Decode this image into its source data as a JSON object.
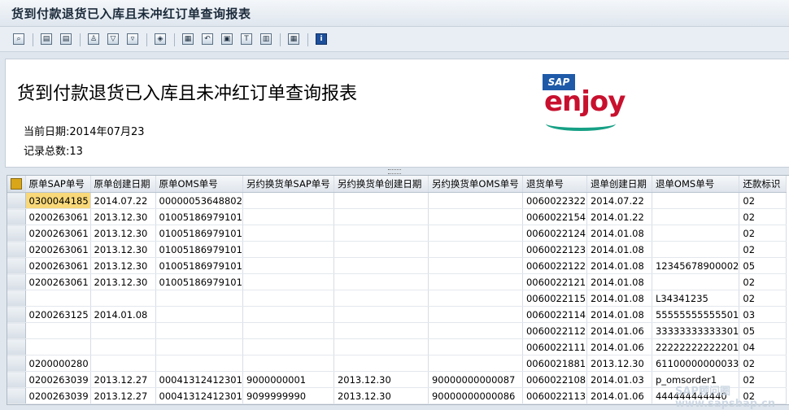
{
  "window": {
    "title": "货到付款退货已入库且未冲红订单查询报表"
  },
  "toolbar": {
    "buttons": [
      {
        "name": "details-icon",
        "glyph": "⌕"
      },
      {
        "name": "sort-ascending-icon",
        "glyph": "▤"
      },
      {
        "name": "sort-descending-icon",
        "glyph": "▤"
      },
      {
        "name": "find-icon",
        "glyph": "♙"
      },
      {
        "name": "filter-icon",
        "glyph": "▽"
      },
      {
        "name": "filter-settings-icon",
        "glyph": "▿"
      },
      {
        "name": "print-preview-icon",
        "glyph": "◈"
      },
      {
        "name": "export-icon",
        "glyph": "▦"
      },
      {
        "name": "send-icon",
        "glyph": "↶"
      },
      {
        "name": "abc-analysis-icon",
        "glyph": "▣"
      },
      {
        "name": "graphic-icon",
        "glyph": "T"
      },
      {
        "name": "layout-icon",
        "glyph": "▥"
      },
      {
        "name": "select-layout-icon",
        "glyph": "▦"
      },
      {
        "name": "info-icon",
        "glyph": "i"
      }
    ]
  },
  "header": {
    "title": "货到付款退货已入库且未冲红订单查询报表",
    "date_line": "当前日期:2014年07月23",
    "count_line": "记录总数:13",
    "logo": {
      "brand": "SAP",
      "word": "enjoy"
    }
  },
  "grid": {
    "columns": [
      "原单SAP单号",
      "原单创建日期",
      "原单OMS单号",
      "另约换货单SAP单号",
      "另约换货单创建日期",
      "另约换货单OMS单号",
      "退货单号",
      "退单创建日期",
      "退单OMS单号",
      "还款标识"
    ],
    "rows": [
      [
        "0300044185",
        "2014.07.22",
        "00000053648802",
        "",
        "",
        "",
        "0060022322",
        "2014.07.22",
        "",
        "02"
      ],
      [
        "0200263061",
        "2013.12.30",
        "01005186979101",
        "",
        "",
        "",
        "0060022154",
        "2014.01.22",
        "",
        "02"
      ],
      [
        "0200263061",
        "2013.12.30",
        "01005186979101",
        "",
        "",
        "",
        "0060022124",
        "2014.01.08",
        "",
        "02"
      ],
      [
        "0200263061",
        "2013.12.30",
        "01005186979101",
        "",
        "",
        "",
        "0060022123",
        "2014.01.08",
        "",
        "02"
      ],
      [
        "0200263061",
        "2013.12.30",
        "01005186979101",
        "",
        "",
        "",
        "0060022122",
        "2014.01.08",
        "12345678900002",
        "05"
      ],
      [
        "0200263061",
        "2013.12.30",
        "01005186979101",
        "",
        "",
        "",
        "0060022121",
        "2014.01.08",
        "",
        "02"
      ],
      [
        "",
        "",
        "",
        "",
        "",
        "",
        "0060022115",
        "2014.01.08",
        "L34341235",
        "02"
      ],
      [
        "0200263125",
        "2014.01.08",
        "",
        "",
        "",
        "",
        "0060022114",
        "2014.01.08",
        "55555555555501",
        "03"
      ],
      [
        "",
        "",
        "",
        "",
        "",
        "",
        "0060022112",
        "2014.01.06",
        "33333333333301",
        "05"
      ],
      [
        "",
        "",
        "",
        "",
        "",
        "",
        "0060022111",
        "2014.01.06",
        "22222222222201",
        "04"
      ],
      [
        "0200000280",
        "",
        "",
        "",
        "",
        "",
        "0060021881",
        "2013.12.30",
        "61100000000033",
        "02"
      ],
      [
        "0200263039",
        "2013.12.27",
        "00041312412301",
        "9000000001",
        "2013.12.30",
        "90000000000087",
        "0060022108",
        "2014.01.03",
        "p_omsorder1",
        "02"
      ],
      [
        "0200263039",
        "2013.12.27",
        "00041312412301",
        "9099999990",
        "2013.12.30",
        "90000000000086",
        "0060022113",
        "2014.01.06",
        "444444444440",
        "02"
      ]
    ],
    "highlighted_cell": {
      "row": 0,
      "col": 0
    }
  },
  "watermark": "SAP顾问圈 www.sapsbap.cn"
}
